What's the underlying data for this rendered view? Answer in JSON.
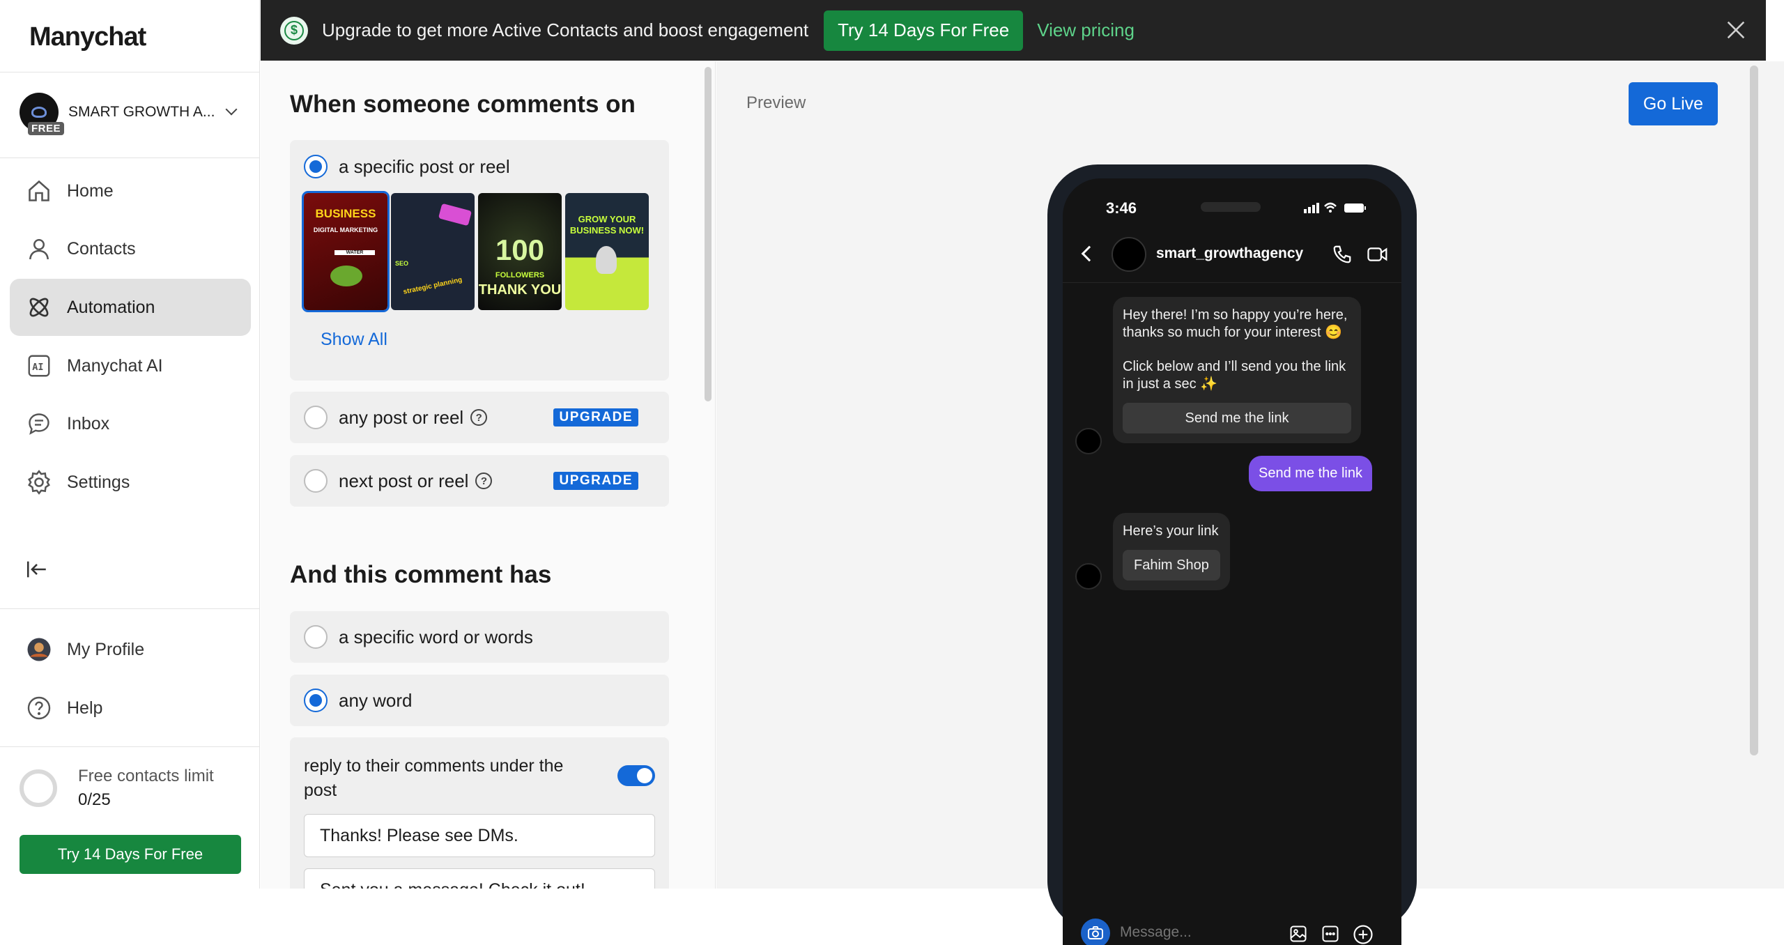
{
  "brand": {
    "logo": "Manychat"
  },
  "account": {
    "name": "SMART GROWTH A...",
    "plan_badge": "FREE"
  },
  "nav": {
    "items": [
      {
        "label": "Home",
        "icon": "home-icon"
      },
      {
        "label": "Contacts",
        "icon": "contacts-icon"
      },
      {
        "label": "Automation",
        "icon": "automation-icon",
        "active": true
      },
      {
        "label": "Manychat AI",
        "icon": "ai-icon"
      },
      {
        "label": "Inbox",
        "icon": "inbox-icon"
      },
      {
        "label": "Settings",
        "icon": "settings-icon"
      }
    ],
    "bottom": [
      {
        "label": "My Profile",
        "icon": "profile-avatar"
      },
      {
        "label": "Help",
        "icon": "help-icon"
      }
    ]
  },
  "limit": {
    "title": "Free contacts limit",
    "count": "0/25"
  },
  "sidebar_trial": "Try 14 Days For Free",
  "banner": {
    "text": "Upgrade to get more Active Contacts and boost engagement",
    "button": "Try 14 Days For Free",
    "link": "View pricing"
  },
  "trigger": {
    "heading": "When someone comments on",
    "options": [
      {
        "label": "a specific post or reel",
        "selected": true
      },
      {
        "label": "any post or reel",
        "selected": false,
        "badge": "UPGRADE"
      },
      {
        "label": "next post or reel",
        "selected": false,
        "badge": "UPGRADE"
      }
    ],
    "show_all": "Show All",
    "thumbnails": [
      {
        "title": "BUSINESS",
        "subtitle": "DIGITAL MARKETING",
        "caption": "WATER"
      },
      {
        "title": "strategic planning",
        "subtitle": "SEO"
      },
      {
        "title": "100",
        "subtitle": "FOLLOWERS",
        "caption": "THANK YOU"
      },
      {
        "title": "GROW YOUR BUSINESS NOW!"
      }
    ]
  },
  "comment": {
    "heading": "And this comment has",
    "options": [
      {
        "label": "a specific word or words",
        "selected": false
      },
      {
        "label": "any word",
        "selected": true
      }
    ],
    "reply_label": "reply to their comments under the post",
    "reply_enabled": true,
    "replies": [
      "Thanks! Please see DMs.",
      "Sent you a message! Check it out!"
    ]
  },
  "preview": {
    "label": "Preview",
    "go_live": "Go Live",
    "phone": {
      "time": "3:46",
      "username": "smart_growthagency",
      "message1_line1": "Hey there! I’m so happy you’re here,",
      "message1_line2": "thanks so much for your interest 😊",
      "message1_line3": "Click below and I’ll send you the link",
      "message1_line4": "in just a sec ✨",
      "message1_button": "Send me the link",
      "user_reply": "Send me the link",
      "message2": "Here’s your link",
      "message2_button": "Fahim Shop",
      "compose_placeholder": "Message..."
    }
  },
  "colors": {
    "accent": "#1469d8",
    "green": "#17873f",
    "banner_bg": "#232323",
    "user_bubble": "#7b4fe6"
  }
}
